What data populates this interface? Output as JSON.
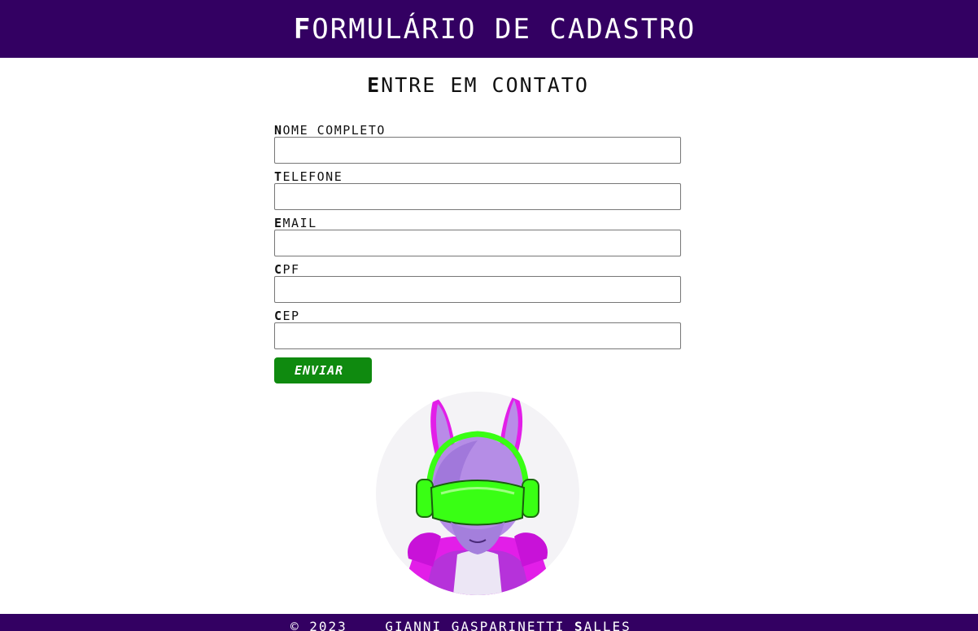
{
  "header": {
    "title_first": "F",
    "title_rest": "ORMULÁRIO DE CADASTRO"
  },
  "subtitle": {
    "first": "E",
    "rest": "NTRE EM CONTATO"
  },
  "form": {
    "fields": [
      {
        "label_first": "N",
        "label_rest": "OME COMPLETO",
        "value": "",
        "placeholder": ""
      },
      {
        "label_first": "T",
        "label_rest": "ELEFONE",
        "value": "",
        "placeholder": ""
      },
      {
        "label_first": "E",
        "label_rest": "MAIL",
        "value": "",
        "placeholder": ""
      },
      {
        "label_first": "C",
        "label_rest": "PF",
        "value": "",
        "placeholder": ""
      },
      {
        "label_first": "C",
        "label_rest": "EP",
        "value": "",
        "placeholder": ""
      }
    ],
    "submit_first": "E",
    "submit_rest": "NVIAR"
  },
  "footer": {
    "text_left": "© 2023    GIANNI GASPARINETTI ",
    "text_bold": "S",
    "text_right": "ALLES"
  },
  "colors": {
    "header_bg": "#330062",
    "button_bg": "#0f8a0f",
    "avatar_magenta": "#e21ee8",
    "avatar_green": "#39ff14"
  }
}
